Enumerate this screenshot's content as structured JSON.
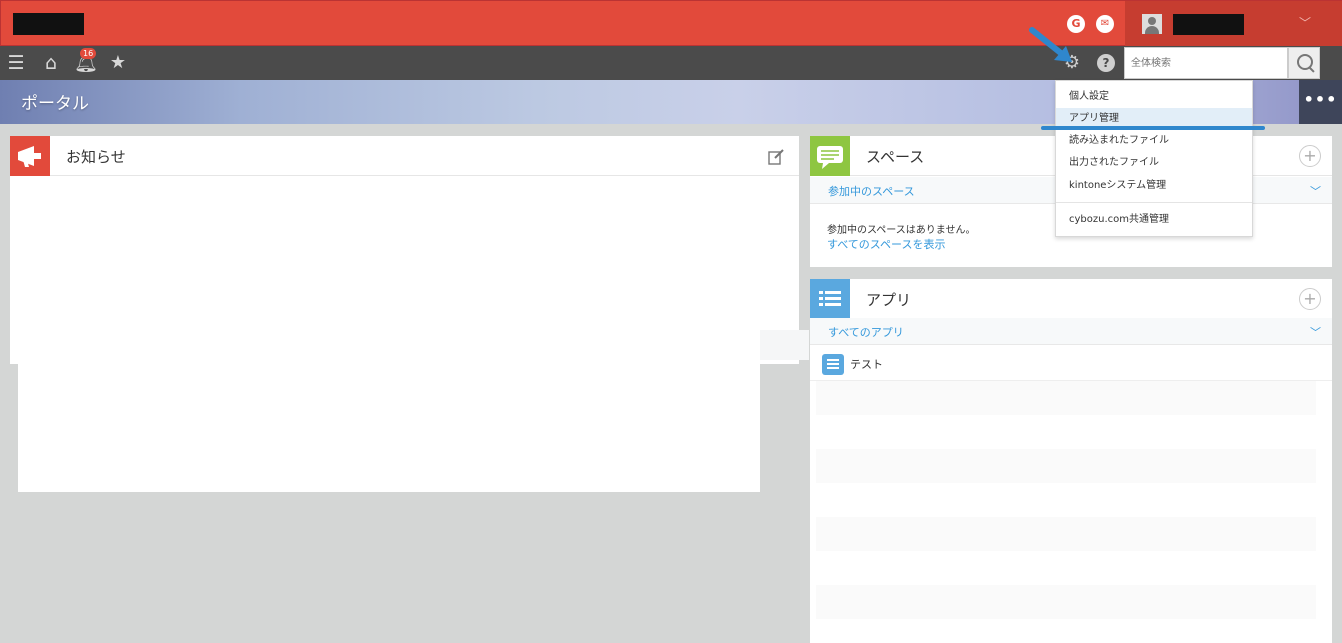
{
  "header": {
    "logo_label": "",
    "user_name": ""
  },
  "toolbar": {
    "notification_count": "16",
    "search_placeholder": "全体検索"
  },
  "banner": {
    "title": "ポータル",
    "more_label": "•••"
  },
  "announcements": {
    "title": "お知らせ"
  },
  "space": {
    "title": "スペース",
    "filter_label": "参加中のスペース",
    "empty_message": "参加中のスペースはありません。",
    "show_all_link": "すべてのスペースを表示"
  },
  "apps": {
    "title": "アプリ",
    "filter_label": "すべてのアプリ",
    "items": [
      {
        "name": "テスト"
      }
    ]
  },
  "settings_menu": {
    "items": [
      {
        "label": "個人設定"
      },
      {
        "label": "アプリ管理"
      },
      {
        "label": "読み込まれたファイル"
      },
      {
        "label": "出力されたファイル"
      },
      {
        "label": "kintoneシステム管理"
      },
      {
        "label": "cybozu.com共通管理"
      }
    ],
    "highlighted_item": "アプリ管理"
  },
  "colors": {
    "header_red": "#e24a3b",
    "toolbar_dark": "#4b4b4b",
    "link_blue": "#3498db",
    "annotation_blue": "#2f87cd"
  }
}
